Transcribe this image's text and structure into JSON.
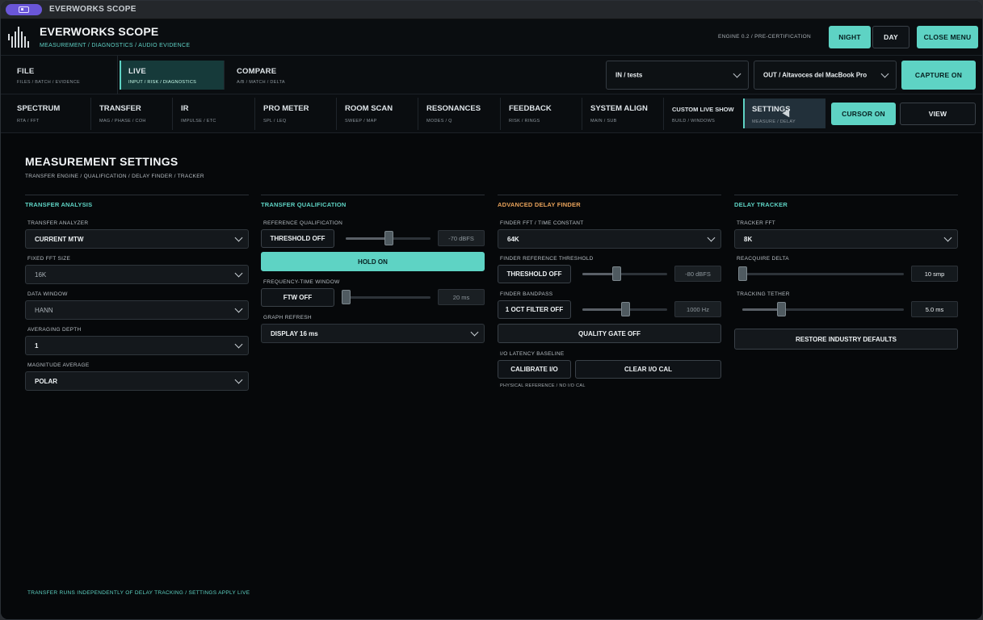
{
  "titlebar": {
    "title": "EVERWORKS SCOPE"
  },
  "header": {
    "app_title": "EVERWORKS SCOPE",
    "app_subtitle": "MEASUREMENT / DIAGNOSTICS / AUDIO EVIDENCE",
    "engine_label": "ENGINE 0.2  /  PRE-CERTIFICATION",
    "night_label": "NIGHT",
    "day_label": "DAY",
    "close_menu_label": "CLOSE MENU"
  },
  "row1": {
    "tabs": [
      {
        "label": "FILE",
        "sub": "FILES / BATCH / EVIDENCE"
      },
      {
        "label": "LIVE",
        "sub": "INPUT / RISK / DIAGNOSTICS"
      },
      {
        "label": "COMPARE",
        "sub": "A/B / MATCH / DELTA"
      }
    ],
    "input_select": "IN / tests",
    "output_select": "OUT / Altavoces del MacBook Pro",
    "capture_label": "CAPTURE ON"
  },
  "row2": {
    "tabs": [
      {
        "label": "SPECTRUM",
        "sub": "RTA / FFT"
      },
      {
        "label": "TRANSFER",
        "sub": "MAG / PHASE / COH"
      },
      {
        "label": "IR",
        "sub": "IMPULSE / ETC"
      },
      {
        "label": "PRO METER",
        "sub": "SPL / LEQ"
      },
      {
        "label": "ROOM SCAN",
        "sub": "SWEEP / MAP"
      },
      {
        "label": "RESONANCES",
        "sub": "MODES / Q"
      },
      {
        "label": "FEEDBACK",
        "sub": "RISK / RINGS"
      },
      {
        "label": "SYSTEM ALIGN",
        "sub": "MAIN / SUB"
      },
      {
        "label": "CUSTOM LIVE SHOW",
        "sub": "BUILD / WINDOWS"
      },
      {
        "label": "SETTINGS",
        "sub": "MEASURE / DELAY"
      }
    ],
    "cursor_label": "CURSOR ON",
    "view_label": "VIEW"
  },
  "settings": {
    "title": "MEASUREMENT SETTINGS",
    "subtitle": "TRANSFER ENGINE / QUALIFICATION / DELAY FINDER / TRACKER",
    "transfer_analysis": {
      "heading": "TRANSFER ANALYSIS",
      "analyzer_label": "TRANSFER ANALYZER",
      "analyzer_value": "CURRENT MTW",
      "fft_label": "FIXED FFT SIZE",
      "fft_value": "16K",
      "window_label": "DATA WINDOW",
      "window_value": "HANN",
      "avg_label": "AVERAGING DEPTH",
      "avg_value": "1",
      "mag_label": "MAGNITUDE AVERAGE",
      "mag_value": "POLAR"
    },
    "transfer_qualification": {
      "heading": "TRANSFER QUALIFICATION",
      "ref_label": "REFERENCE QUALIFICATION",
      "threshold_btn": "THRESHOLD OFF",
      "threshold_value": "-70 dBFS",
      "threshold_level": 0.5,
      "hold_btn": "HOLD ON",
      "ftw_label": "FREQUENCY-TIME WINDOW",
      "ftw_btn": "FTW OFF",
      "ftw_value": "20 ms",
      "ftw_level": 0.0,
      "refresh_label": "GRAPH REFRESH",
      "refresh_value": "DISPLAY 16 ms"
    },
    "advanced_delay": {
      "heading": "ADVANCED DELAY FINDER",
      "fft_label": "FINDER FFT / TIME CONSTANT",
      "fft_value": "64K",
      "ref_label": "FINDER REFERENCE THRESHOLD",
      "ref_btn": "THRESHOLD OFF",
      "ref_value": "-80 dBFS",
      "ref_level": 0.4,
      "bandpass_label": "FINDER BANDPASS",
      "bandpass_btn": "1 OCT FILTER OFF",
      "bandpass_value": "1000 Hz",
      "bandpass_level": 0.5,
      "quality_btn": "QUALITY GATE OFF",
      "latency_label": "I/O LATENCY BASELINE",
      "calibrate_btn": "CALIBRATE I/O",
      "clear_btn": "CLEAR I/O CAL",
      "physical_note": "PHYSICAL REFERENCE / NO I/O CAL"
    },
    "delay_tracker": {
      "heading": "DELAY TRACKER",
      "fft_label": "TRACKER FFT",
      "fft_value": "8K",
      "reacquire_label": "REACQUIRE DELTA",
      "reacquire_value": "10 smp",
      "reacquire_level": 0.0,
      "tether_label": "TRACKING TETHER",
      "tether_value": "5.0 ms",
      "tether_level": 0.24,
      "restore_btn": "RESTORE INDUSTRY DEFAULTS"
    },
    "footer_note": "TRANSFER RUNS INDEPENDENTLY OF DELAY TRACKING / SETTINGS APPLY LIVE"
  },
  "colors": {
    "accent": "#5ed3c4",
    "orange_heading": "#e8a25a",
    "background": "#06080a"
  }
}
